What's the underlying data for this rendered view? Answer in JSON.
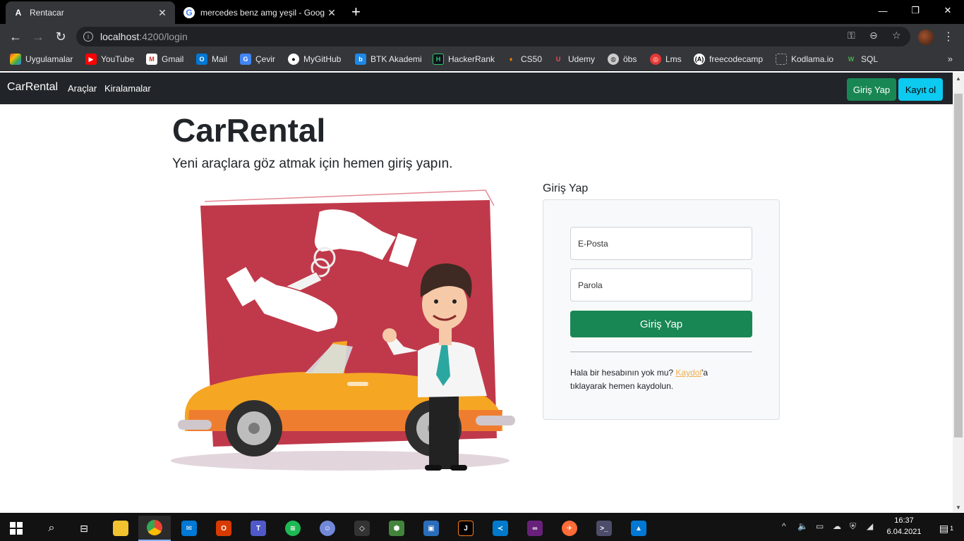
{
  "browser": {
    "tabs": [
      {
        "title": "Rentacar",
        "favicon": "A",
        "active": true
      },
      {
        "title": "mercedes benz amg yeşil - Goog",
        "favicon": "G",
        "active": false
      }
    ],
    "url_host": "localhost",
    "url_path": ":4200/login",
    "bookmarks": [
      {
        "label": "Uygulamalar",
        "icon": "apps-icon",
        "color": "#ea4335"
      },
      {
        "label": "YouTube",
        "icon": "youtube-icon",
        "color": "#ff0000"
      },
      {
        "label": "Gmail",
        "icon": "gmail-icon",
        "color": "#d93025"
      },
      {
        "label": "Mail",
        "icon": "outlook-icon",
        "color": "#0078d4"
      },
      {
        "label": "Çevir",
        "icon": "translate-icon",
        "color": "#4285f4"
      },
      {
        "label": "MyGitHub",
        "icon": "github-icon",
        "color": "#ffffff"
      },
      {
        "label": "BTK Akademi",
        "icon": "btk-icon",
        "color": "#1e88e5"
      },
      {
        "label": "HackerRank",
        "icon": "hackerrank-icon",
        "color": "#2ec866"
      },
      {
        "label": "CS50",
        "icon": "cs50-icon",
        "color": "#f57c00"
      },
      {
        "label": "Udemy",
        "icon": "udemy-icon",
        "color": "#ec5252"
      },
      {
        "label": "öbs",
        "icon": "globe-icon",
        "color": "#cccccc"
      },
      {
        "label": "Lms",
        "icon": "lms-icon",
        "color": "#e53935"
      },
      {
        "label": "freecodecamp",
        "icon": "freecodecamp-icon",
        "color": "#ffffff"
      },
      {
        "label": "Kodlama.io",
        "icon": "kodlama-icon",
        "color": "#9e9e9e"
      },
      {
        "label": "SQL",
        "icon": "sql-icon",
        "color": "#4caf50"
      }
    ]
  },
  "navbar": {
    "brand": "CarRental",
    "links": [
      "Araçlar",
      "Kiralamalar"
    ],
    "login_label": "Giriş Yap",
    "register_label": "Kayıt ol"
  },
  "hero": {
    "title": "CarRental",
    "subtitle": "Yeni araçlara göz atmak için hemen giriş yapın."
  },
  "login_form": {
    "heading": "Giriş Yap",
    "email_placeholder": "E-Posta",
    "password_placeholder": "Parola",
    "submit_label": "Giriş Yap",
    "note_prefix": "Hala bir hesabının yok mu? ",
    "note_link": "Kaydol",
    "note_suffix": "'a tıklayarak hemen kaydolun."
  },
  "taskbar": {
    "time": "16:37",
    "date": "6.04.2021",
    "notifications": "1"
  },
  "colors": {
    "success": "#198754",
    "info": "#0dcaf0",
    "navbar": "#212529",
    "link": "#f0ad4e"
  }
}
